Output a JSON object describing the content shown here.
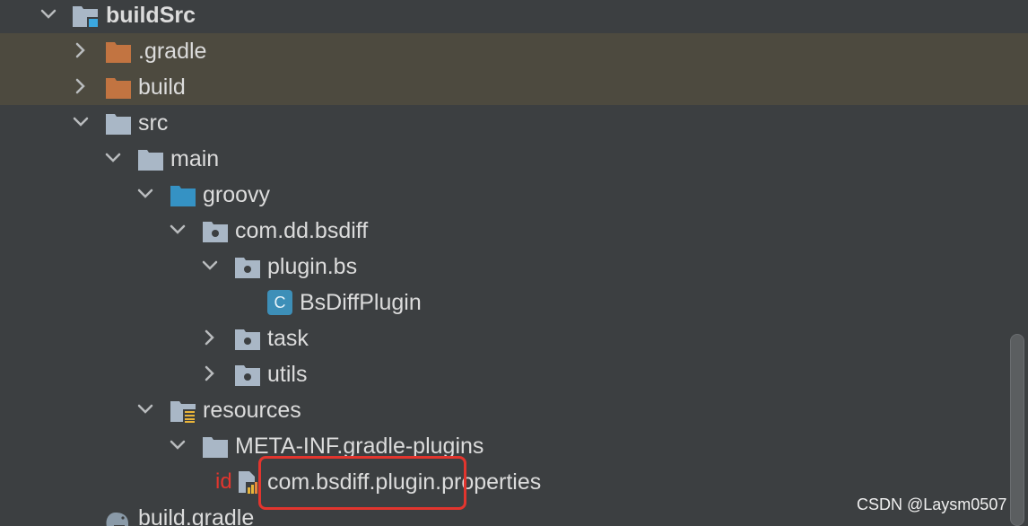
{
  "tree": [
    {
      "label": "buildSrc",
      "icon": "module-folder-icon",
      "expanded": true
    },
    {
      "label": ".gradle",
      "icon": "excluded-folder-icon",
      "expanded": false,
      "excluded": true
    },
    {
      "label": "build",
      "icon": "excluded-folder-icon",
      "expanded": false,
      "excluded": true
    },
    {
      "label": "src",
      "icon": "folder-icon",
      "expanded": true
    },
    {
      "label": "main",
      "icon": "folder-icon",
      "expanded": true
    },
    {
      "label": "groovy",
      "icon": "source-root-folder-icon",
      "expanded": true
    },
    {
      "label": "com.dd.bsdiff",
      "icon": "package-icon",
      "expanded": true
    },
    {
      "label": "plugin.bs",
      "icon": "package-icon",
      "expanded": true
    },
    {
      "label": "BsDiffPlugin",
      "icon": "groovy-class-icon",
      "badge": "C"
    },
    {
      "label": "task",
      "icon": "package-icon",
      "expanded": false
    },
    {
      "label": "utils",
      "icon": "package-icon",
      "expanded": false
    },
    {
      "label": "resources",
      "icon": "resources-folder-icon",
      "expanded": true
    },
    {
      "label": "META-INF.gradle-plugins",
      "icon": "folder-icon",
      "expanded": true
    },
    {
      "label": "com.bsdiff.plugin.properties",
      "icon": "properties-file-icon",
      "prefix": "id"
    },
    {
      "label": "build.gradle",
      "icon": "gradle-elephant-icon"
    }
  ],
  "colors": {
    "background": "#3c3f41",
    "excluded_row": "#4d4a3f",
    "folder": "#a9b7c6",
    "excluded_folder": "#c27441",
    "source_folder": "#3592c4",
    "class_badge": "#3d8fb8",
    "highlight": "#e2352e"
  },
  "watermark": "CSDN @Laysm0507"
}
